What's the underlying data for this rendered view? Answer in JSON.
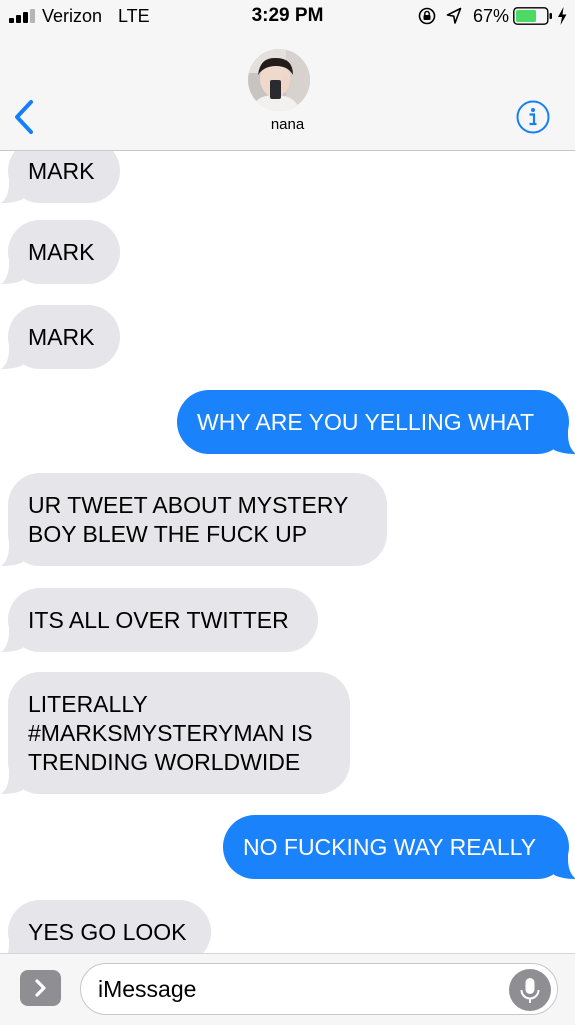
{
  "status_bar": {
    "carrier": "Verizon",
    "network": "LTE",
    "time": "3:29 PM",
    "battery_percent": "67%",
    "battery_level": 0.67,
    "signal_bars": 3,
    "icons": [
      "signal-icon",
      "rotation-lock-icon",
      "location-arrow-icon",
      "battery-icon",
      "charging-bolt-icon"
    ]
  },
  "header": {
    "contact_name": "nana",
    "back_icon": "chevron-left-icon",
    "info_icon": "info-icon"
  },
  "conversation": {
    "messages": [
      {
        "direction": "incoming",
        "lines": [
          "MARK"
        ]
      },
      {
        "direction": "incoming",
        "lines": [
          "MARK"
        ]
      },
      {
        "direction": "incoming",
        "lines": [
          "MARK"
        ]
      },
      {
        "direction": "outgoing",
        "lines": [
          "WHY ARE YOU YELLING WHAT"
        ]
      },
      {
        "direction": "incoming",
        "lines": [
          "UR TWEET ABOUT MYSTERY",
          "BOY BLEW THE FUCK UP"
        ]
      },
      {
        "direction": "incoming",
        "lines": [
          "ITS ALL OVER TWITTER"
        ]
      },
      {
        "direction": "incoming",
        "lines": [
          "LITERALLY",
          "#MARKSMYSTERYMAN IS",
          "TRENDING WORLDWIDE"
        ]
      },
      {
        "direction": "outgoing",
        "lines": [
          "NO FUCKING WAY REALLY"
        ]
      },
      {
        "direction": "incoming",
        "lines": [
          "YES GO LOOK"
        ]
      }
    ]
  },
  "input_bar": {
    "placeholder": "iMessage",
    "apps_icon": "chevron-right-icon",
    "mic_icon": "microphone-icon"
  },
  "colors": {
    "bar_background": "#f6f6f6",
    "incoming_bubble": "#e5e5ea",
    "outgoing_bubble": "#1a82fb",
    "accent": "#147efb",
    "battery_fill": "#4cd964"
  }
}
